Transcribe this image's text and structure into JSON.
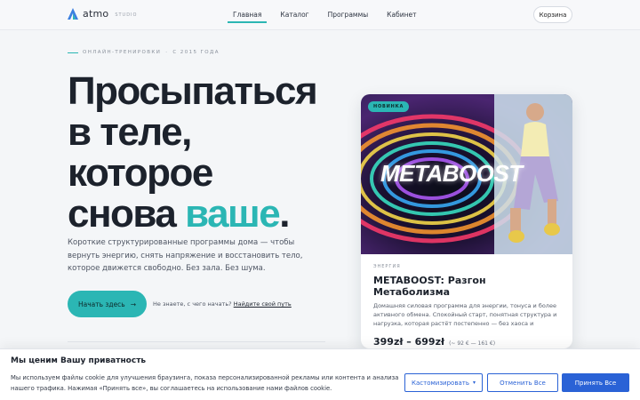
{
  "header": {
    "logo_text": "atmo",
    "logo_sub": "STUDIO",
    "nav": [
      {
        "label": "Главная",
        "active": true
      },
      {
        "label": "Каталог",
        "active": false
      },
      {
        "label": "Программы",
        "active": false
      },
      {
        "label": "Кабинет",
        "active": false
      }
    ],
    "cart_label": "Корзина"
  },
  "hero": {
    "eyebrow_left": "ОНЛАЙН-ТРЕНИРОВКИ",
    "eyebrow_sep": "·",
    "eyebrow_right": "С 2015 ГОДА",
    "title_l1": "Просыпаться",
    "title_l2": "в теле,",
    "title_l3": "которое",
    "title_l4a": "снова ",
    "title_l4_accent": "ваше",
    "title_l4b": ".",
    "description": "Короткие структурированные программы дома — чтобы вернуть энергию, снять напряжение и восстановить тело, которое движется свободно. Без зала. Без шума.",
    "cta_label": "Начать здесь",
    "cta_arrow": "→",
    "hint_text": "Не знаете, с чего начать?",
    "hint_link": "Найдите свой путь"
  },
  "card": {
    "badge": "НОВИНКА",
    "image_title": "METABOOST",
    "category": "ЭНЕРГИЯ",
    "title": "METABOOST: Разгон Метаболизма",
    "description": "Домашняя силовая программа для энергии, тонуса и более активного обмена. Спокойный старт, понятная структура и нагрузка, которая растёт постепенно — без хаоса и резкого...",
    "price": "399zł – 699zł",
    "price_alt": "(~ 92 € — 161 €)"
  },
  "cookie": {
    "title": "Мы ценим Вашу приватность",
    "text": "Мы используем файлы cookie для улучшения браузинга, показа персонализированной рекламы или контента и анализа нашего трафика. Нажимая «Принять все», вы соглашаетесь на использование нами файлов cookie.",
    "customize": "Кастомизировать",
    "customize_icon": "caret-down",
    "reject": "Отменить Все",
    "accept": "Принять Все"
  },
  "colors": {
    "accent": "#2bb6b4",
    "cookie_blue": "#2a62d6"
  }
}
